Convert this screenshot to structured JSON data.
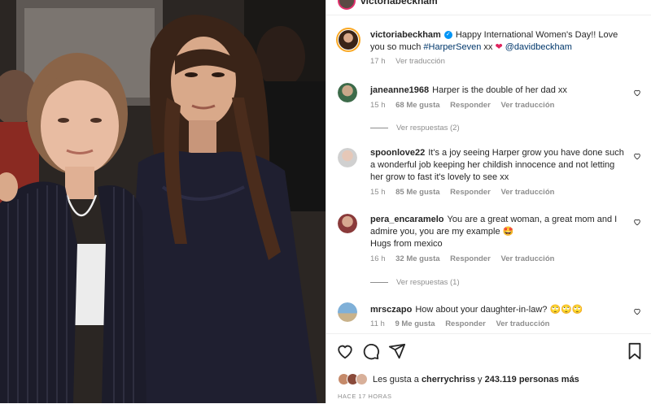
{
  "post": {
    "top_username": "victoriabeckham",
    "caption": {
      "username": "victoriabeckham",
      "text_before": "Happy International Women's Day!! Love you so much ",
      "hashtag": "#HarperSeven",
      "text_after": " xx ",
      "mention": "@davidbeckham",
      "time": "17 h",
      "translate": "Ver traducción"
    }
  },
  "comments": [
    {
      "username": "janeanne1968",
      "text": "Harper is the double of her dad xx",
      "time": "15 h",
      "likes": "68 Me gusta",
      "reply": "Responder",
      "translate": "Ver traducción",
      "view_replies": "Ver respuestas (2)"
    },
    {
      "username": "spoonlove22",
      "text": "It's a joy seeing Harper grow you have done such a wonderful job keeping her childish innocence and not letting her grow to fast it's lovely to see xx",
      "time": "15 h",
      "likes": "85 Me gusta",
      "reply": "Responder",
      "translate": "Ver traducción"
    },
    {
      "username": "pera_encaramelo",
      "text": "You are a great woman, a great mom and I admire you, you are my example 🤩",
      "text2": "Hugs from mexico",
      "time": "16 h",
      "likes": "32 Me gusta",
      "reply": "Responder",
      "translate": "Ver traducción",
      "view_replies": "Ver respuestas (1)"
    },
    {
      "username": "mrsczapo",
      "text": "How about your daughter-in-law? 🙄🙄🙄",
      "time": "11 h",
      "likes": "9 Me gusta",
      "reply": "Responder",
      "translate": "Ver traducción"
    }
  ],
  "likes": {
    "prefix": "Les gusta a ",
    "user": "cherrychriss",
    "middle": " y ",
    "count": "243.119 personas más"
  },
  "time_ago": "HACE 17 HORAS",
  "colors": {
    "link": "#00376b",
    "muted": "#8e8e8e",
    "verified": "#0095f6",
    "heart": "#e0245e"
  }
}
